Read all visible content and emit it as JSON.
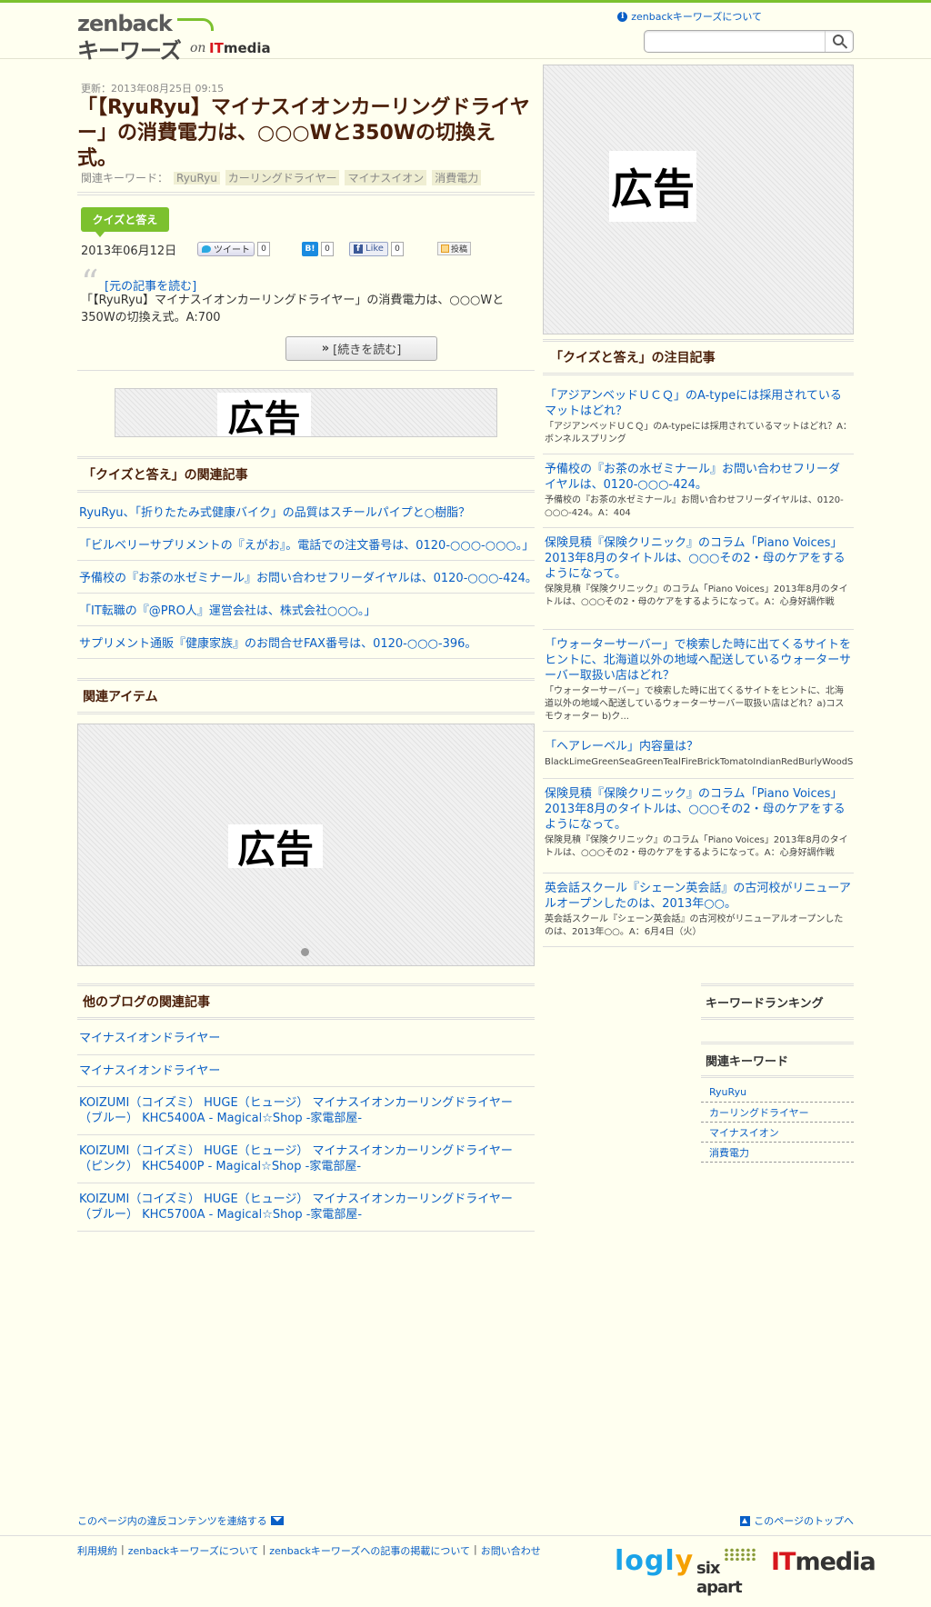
{
  "header": {
    "logo_line1": "zenback",
    "logo_line2": "キーワーズ",
    "logo_on": "on",
    "logo_it": "IT",
    "logo_media": "media",
    "about_link": "zenbackキーワーズについて",
    "search_placeholder": ""
  },
  "article": {
    "updated": "更新：2013年08月25日 09:15",
    "title": "「【RyuRyu】マイナスイオンカーリングドライヤー」の消費電力は、○○○Wと350Wの切換え式。",
    "keywords_label": "関連キーワード：",
    "keywords": [
      "RyuRyu",
      "カーリングドライヤー",
      "マイナスイオン",
      "消費電力"
    ],
    "category": "クイズと答え",
    "date": "2013年06月12日",
    "tweet_label": "ツイート",
    "tweet_count": "0",
    "hatena_label": "B!",
    "hatena_count": "0",
    "like_label": "Like",
    "like_count": "0",
    "post_label": "投稿",
    "orig_link": "[元の記事を読む]",
    "excerpt": "「【RyuRyu】マイナスイオンカーリングドライヤー」の消費電力は、○○○Wと350Wの切換え式。A:700",
    "more_label": "[続きを読む]"
  },
  "ads": {
    "label": "広告"
  },
  "related": {
    "heading": "「クイズと答え」の関連記事",
    "items": [
      "RyuRyu、「折りたたみ式健康バイク」の品質はスチールパイプと○樹脂？",
      "「ビルベリーサプリメントの『えがお』。電話での注文番号は、0120-○○○-○○○。」",
      "予備校の『お茶の水ゼミナール』お問い合わせフリーダイヤルは、0120-○○○-424。",
      "「IT転職の『@PRO人』運営会社は、株式会社○○○。」",
      "サプリメント通販『健康家族』のお問合せFAX番号は、0120-○○○-396。"
    ]
  },
  "items_section": {
    "heading": "関連アイテム"
  },
  "blogs": {
    "heading": "他のブログの関連記事",
    "items": [
      "マイナスイオンドライヤー",
      "マイナスイオンドライヤー",
      "KOIZUMI（コイズミ） HUGE（ヒュージ） マイナスイオンカーリングドライヤー（ブルー） KHC5400A - Magical☆Shop -家電部屋-",
      "KOIZUMI（コイズミ） HUGE（ヒュージ） マイナスイオンカーリングドライヤー（ピンク） KHC5400P - Magical☆Shop -家電部屋-",
      "KOIZUMI（コイズミ） HUGE（ヒュージ） マイナスイオンカーリングドライヤー（ブルー） KHC5700A - Magical☆Shop -家電部屋-"
    ]
  },
  "sidebar": {
    "hot_heading": "「クイズと答え」の注目記事",
    "hot": [
      {
        "title": "「アジアンベッドＵＣＱ」のA-typeには採用されているマットはどれ？",
        "desc": "「アジアンベッドＵＣＱ」のA-typeには採用されているマットはどれ？A：ボンネルスプリング"
      },
      {
        "title": "予備校の『お茶の水ゼミナール』お問い合わせフリーダイヤルは、0120-○○○-424。",
        "desc": "予備校の『お茶の水ゼミナール』お問い合わせフリーダイヤルは、0120-○○○-424。A：404"
      },
      {
        "title": "保険見積『保険クリニック』のコラム「Piano Voices」2013年8月のタイトルは、○○○その2・母のケアをするようになって。",
        "desc": "保険見積『保険クリニック』のコラム「Piano Voices」2013年8月のタイトルは、○○○その2・母のケアをするようになって。A：心身好調作戦"
      },
      {
        "title": "「ウォーターサーバー」で検索した時に出てくるサイトをヒントに、北海道以外の地域へ配送しているウォーターサーバー取扱い店はどれ？",
        "desc": "「ウォーターサーバー」で検索した時に出てくるサイトをヒントに、北海道以外の地域へ配送しているウォーターサーバー取扱い店はどれ？a)コスモウォーター b)ク..."
      },
      {
        "title": "「ヘアレーベル」内容量は？",
        "desc": "BlackLimeGreenSeaGreenTealFireBrickTomatoIndianRedBurlyWoodSlateGrayD"
      },
      {
        "title": "保険見積『保険クリニック』のコラム「Piano Voices」2013年8月のタイトルは、○○○その2・母のケアをするようになって。",
        "desc": "保険見積『保険クリニック』のコラム「Piano Voices」2013年8月のタイトルは、○○○その2・母のケアをするようになって。A：心身好調作戦"
      },
      {
        "title": "英会話スクール『シェーン英会話』の古河校がリニューアルオープンしたのは、2013年○○。",
        "desc": "英会話スクール『シェーン英会話』の古河校がリニューアルオープンしたのは、2013年○○。A：6月4日（火）"
      }
    ],
    "ranking_heading": "キーワードランキング",
    "related_kw_heading": "関連キーワード",
    "related_kw": [
      "RyuRyu",
      "カーリングドライヤー",
      "マイナスイオン",
      "消費電力"
    ]
  },
  "footer": {
    "report": "このページ内の違反コンテンツを連絡する",
    "totop": "このページのトップへ",
    "links": [
      "利用規約",
      "|",
      "zenbackキーワーズについて",
      "|",
      "zenbackキーワーズへの記事の掲載について",
      "|",
      "お問い合わせ"
    ],
    "logo_logly": "logl",
    "logo_logly_y": "y",
    "logo_sixapart": "six apart",
    "logo_it": "IT",
    "logo_media": "media"
  }
}
